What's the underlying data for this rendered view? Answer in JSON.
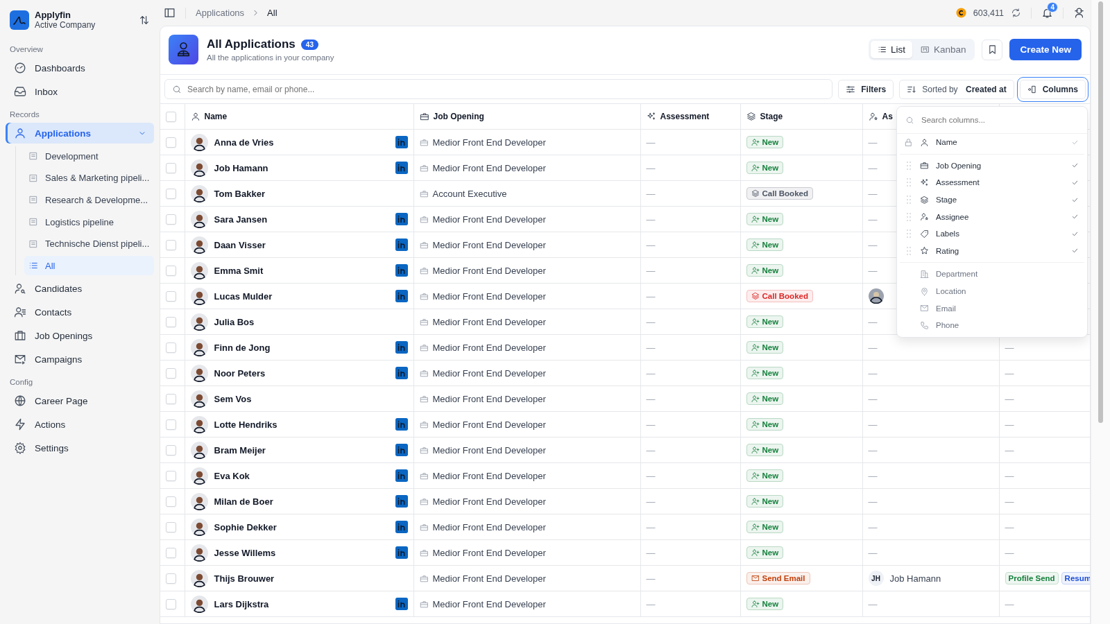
{
  "workspace": {
    "name": "Applyfin",
    "subtitle": "Active Company"
  },
  "sidebar": {
    "sections": [
      {
        "title": "Overview",
        "items": [
          {
            "label": "Dashboards",
            "selected": false
          },
          {
            "label": "Inbox",
            "selected": false
          }
        ]
      },
      {
        "title": "Records",
        "items": [
          {
            "label": "Applications",
            "selected": true,
            "expanded": true,
            "children": [
              {
                "label": "Development",
                "selected": false
              },
              {
                "label": "Sales & Marketing pipeli...",
                "selected": false
              },
              {
                "label": "Research & Developme...",
                "selected": false
              },
              {
                "label": "Logistics pipeline",
                "selected": false
              },
              {
                "label": "Technische Dienst pipeli...",
                "selected": false
              },
              {
                "label": "All",
                "selected": true
              }
            ]
          },
          {
            "label": "Candidates",
            "selected": false
          },
          {
            "label": "Contacts",
            "selected": false
          },
          {
            "label": "Job Openings",
            "selected": false
          },
          {
            "label": "Campaigns",
            "selected": false
          }
        ]
      },
      {
        "title": "Config",
        "items": [
          {
            "label": "Career Page",
            "selected": false
          },
          {
            "label": "Actions",
            "selected": false
          },
          {
            "label": "Settings",
            "selected": false
          }
        ]
      }
    ]
  },
  "breadcrumb": [
    "Applications",
    "All"
  ],
  "credits": "603,411",
  "notifications": "4",
  "page": {
    "title": "All Applications",
    "count": "43",
    "subtitle": "All the applications in your company"
  },
  "views": [
    {
      "label": "List",
      "selected": true
    },
    {
      "label": "Kanban",
      "selected": false
    }
  ],
  "create_button": "Create New",
  "search": {
    "placeholder": "Search by name, email or phone..."
  },
  "filters_button": "Filters",
  "sort": {
    "prefix": "Sorted by",
    "field": "Created at"
  },
  "columns_button": {
    "label": "Columns",
    "selected": true
  },
  "table": {
    "header_checkbox": {
      "checked": false
    },
    "columns": [
      "Name",
      "Job Opening",
      "Assessment",
      "Stage",
      "As"
    ],
    "rows": [
      {
        "selected": false,
        "name": "Anna de Vries",
        "linkedin": true,
        "job": "Medior Front End Developer",
        "assessment": "—",
        "stage": {
          "kind": "new",
          "label": "New",
          "color": "#15803d"
        },
        "assignee": {
          "kind": "empty",
          "text": "—"
        }
      },
      {
        "selected": false,
        "name": "Job Hamann",
        "linkedin": true,
        "job": "Medior Front End Developer",
        "assessment": "—",
        "stage": {
          "kind": "new",
          "label": "New",
          "color": "#15803d"
        },
        "assignee": {
          "kind": "empty",
          "text": "—"
        }
      },
      {
        "selected": false,
        "name": "Tom Bakker",
        "linkedin": false,
        "job": "Account Executive",
        "assessment": "—",
        "stage": {
          "kind": "call",
          "label": "Call Booked",
          "color": "#4b5563"
        },
        "assignee": {
          "kind": "empty",
          "text": "—"
        }
      },
      {
        "selected": false,
        "name": "Sara Jansen",
        "linkedin": true,
        "job": "Medior Front End Developer",
        "assessment": "—",
        "stage": {
          "kind": "new",
          "label": "New",
          "color": "#15803d"
        },
        "assignee": {
          "kind": "empty",
          "text": "—"
        }
      },
      {
        "selected": false,
        "name": "Daan Visser",
        "linkedin": true,
        "job": "Medior Front End Developer",
        "assessment": "—",
        "stage": {
          "kind": "new",
          "label": "New",
          "color": "#15803d"
        },
        "assignee": {
          "kind": "empty",
          "text": "—"
        }
      },
      {
        "selected": false,
        "name": "Emma Smit",
        "linkedin": true,
        "job": "Medior Front End Developer",
        "assessment": "—",
        "stage": {
          "kind": "new",
          "label": "New",
          "color": "#15803d"
        },
        "assignee": {
          "kind": "empty",
          "text": "—"
        }
      },
      {
        "selected": false,
        "name": "Lucas Mulder",
        "linkedin": true,
        "job": "Medior Front End Developer",
        "assessment": "—",
        "stage": {
          "kind": "call",
          "label": "Call Booked",
          "color": "#dc2626"
        },
        "assignee": {
          "kind": "avatar"
        }
      },
      {
        "selected": false,
        "name": "Julia Bos",
        "linkedin": false,
        "job": "Medior Front End Developer",
        "assessment": "—",
        "stage": {
          "kind": "new",
          "label": "New",
          "color": "#15803d"
        },
        "assignee": {
          "kind": "empty",
          "text": "—"
        }
      },
      {
        "selected": false,
        "name": "Finn de Jong",
        "linkedin": true,
        "job": "Medior Front End Developer",
        "assessment": "—",
        "stage": {
          "kind": "new",
          "label": "New",
          "color": "#15803d"
        },
        "assignee": {
          "kind": "empty",
          "text": "—"
        },
        "column_7": {
          "kind": "empty",
          "text": "—"
        }
      },
      {
        "selected": false,
        "name": "Noor Peters",
        "linkedin": true,
        "job": "Medior Front End Developer",
        "assessment": "—",
        "stage": {
          "kind": "new",
          "label": "New",
          "color": "#15803d"
        },
        "assignee": {
          "kind": "empty",
          "text": "—"
        },
        "column_7": {
          "kind": "empty",
          "text": "—"
        }
      },
      {
        "selected": false,
        "name": "Sem Vos",
        "linkedin": false,
        "job": "Medior Front End Developer",
        "assessment": "—",
        "stage": {
          "kind": "new",
          "label": "New",
          "color": "#15803d"
        },
        "assignee": {
          "kind": "empty",
          "text": "—"
        },
        "column_7": {
          "kind": "empty",
          "text": "—"
        }
      },
      {
        "selected": false,
        "name": "Lotte Hendriks",
        "linkedin": true,
        "job": "Medior Front End Developer",
        "assessment": "—",
        "stage": {
          "kind": "new",
          "label": "New",
          "color": "#15803d"
        },
        "assignee": {
          "kind": "empty",
          "text": "—"
        },
        "column_7": {
          "kind": "empty",
          "text": "—"
        }
      },
      {
        "selected": false,
        "name": "Bram Meijer",
        "linkedin": true,
        "job": "Medior Front End Developer",
        "assessment": "—",
        "stage": {
          "kind": "new",
          "label": "New",
          "color": "#15803d"
        },
        "assignee": {
          "kind": "empty",
          "text": "—"
        },
        "column_7": {
          "kind": "empty",
          "text": "—"
        }
      },
      {
        "selected": false,
        "name": "Eva Kok",
        "linkedin": true,
        "job": "Medior Front End Developer",
        "assessment": "—",
        "stage": {
          "kind": "new",
          "label": "New",
          "color": "#15803d"
        },
        "assignee": {
          "kind": "empty",
          "text": "—"
        },
        "column_7": {
          "kind": "empty",
          "text": "—"
        }
      },
      {
        "selected": false,
        "name": "Milan de Boer",
        "linkedin": true,
        "job": "Medior Front End Developer",
        "assessment": "—",
        "stage": {
          "kind": "new",
          "label": "New",
          "color": "#15803d"
        },
        "assignee": {
          "kind": "empty",
          "text": "—"
        },
        "column_7": {
          "kind": "empty",
          "text": "—"
        }
      },
      {
        "selected": false,
        "name": "Sophie Dekker",
        "linkedin": true,
        "job": "Medior Front End Developer",
        "assessment": "—",
        "stage": {
          "kind": "new",
          "label": "New",
          "color": "#15803d"
        },
        "assignee": {
          "kind": "empty",
          "text": "—"
        },
        "column_7": {
          "kind": "empty",
          "text": "—"
        }
      },
      {
        "selected": false,
        "name": "Jesse Willems",
        "linkedin": true,
        "job": "Medior Front End Developer",
        "assessment": "—",
        "stage": {
          "kind": "new",
          "label": "New",
          "color": "#15803d"
        },
        "assignee": {
          "kind": "empty",
          "text": "—"
        },
        "column_7": {
          "kind": "empty",
          "text": "—"
        }
      },
      {
        "selected": false,
        "name": "Thijs Brouwer",
        "linkedin": false,
        "job": "Medior Front End Developer",
        "assessment": "—",
        "stage": {
          "kind": "email",
          "label": "Send Email",
          "color": "#c2410c"
        },
        "assignee": {
          "kind": "user",
          "initials": "JH",
          "name": "Job Hamann"
        },
        "column_7": {
          "kind": "tags",
          "tags": [
            {
              "text": "Profile Send",
              "color": "#15803d"
            },
            {
              "text": "Resum",
              "color": "#1d4ed8"
            }
          ]
        }
      },
      {
        "selected": false,
        "name": "Lars Dijkstra",
        "linkedin": true,
        "job": "Medior Front End Developer",
        "assessment": "—",
        "stage": {
          "kind": "new",
          "label": "New",
          "color": "#15803d"
        },
        "assignee": {
          "kind": "empty",
          "text": "—"
        },
        "column_7": {
          "kind": "empty",
          "text": "—"
        }
      }
    ]
  },
  "columns_menu": {
    "placeholder": "Search columns...",
    "items": [
      {
        "label": "Name",
        "checked": true,
        "locked": true
      },
      {
        "label": "Job Opening",
        "checked": true,
        "locked": false
      },
      {
        "label": "Assessment",
        "checked": true,
        "locked": false
      },
      {
        "label": "Stage",
        "checked": true,
        "locked": false
      },
      {
        "label": "Assignee",
        "checked": true,
        "locked": false
      },
      {
        "label": "Labels",
        "checked": true,
        "locked": false
      },
      {
        "label": "Rating",
        "checked": true,
        "locked": false
      },
      {
        "label": "Department",
        "checked": false,
        "locked": false
      },
      {
        "label": "Location",
        "checked": false,
        "locked": false
      },
      {
        "label": "Email",
        "checked": false,
        "locked": false
      },
      {
        "label": "Phone",
        "checked": false,
        "locked": false
      }
    ]
  }
}
